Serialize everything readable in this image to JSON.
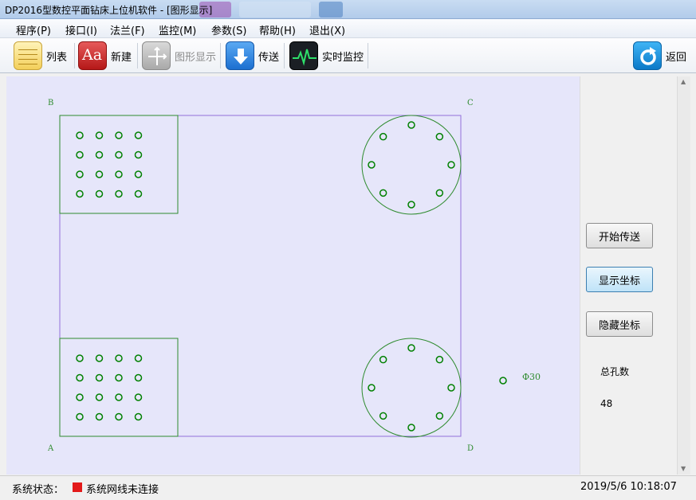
{
  "window": {
    "title": "DP2016型数控平面钻床上位机软件 - [图形显示]"
  },
  "menu": [
    {
      "id": "program",
      "label": "程序(P)"
    },
    {
      "id": "interface",
      "label": "接口(I)"
    },
    {
      "id": "flange",
      "label": "法兰(F)"
    },
    {
      "id": "monitor",
      "label": "监控(M)"
    },
    {
      "id": "params",
      "label": "参数(S)"
    },
    {
      "id": "help",
      "label": "帮助(H)"
    },
    {
      "id": "exit",
      "label": "退出(X)"
    }
  ],
  "toolbar": {
    "list_label": "列表",
    "new_label": "新建",
    "graph_label": "图形显示",
    "send_label": "传送",
    "monitor_label": "实时监控",
    "back_label": "返回"
  },
  "drawing": {
    "corner_labels": {
      "A": "A",
      "B": "B",
      "C": "C",
      "D": "D"
    },
    "hole_diameter_label": "Φ30"
  },
  "side_panel": {
    "start_send": "开始传送",
    "show_coords": "显示坐标",
    "hide_coords": "隐藏坐标",
    "total_holes_label": "总孔数",
    "total_holes_value": "48"
  },
  "status": {
    "label": "系统状态：",
    "connection_text": "系统网线未连接",
    "indicator_color": "#e31a1a",
    "datetime": "2019/5/6 10:18:07"
  },
  "colors": {
    "canvas_bg": "#e6e6fa",
    "outline": "#9370db",
    "group_stroke": "#2e8b2e",
    "hole_stroke": "#008000"
  }
}
